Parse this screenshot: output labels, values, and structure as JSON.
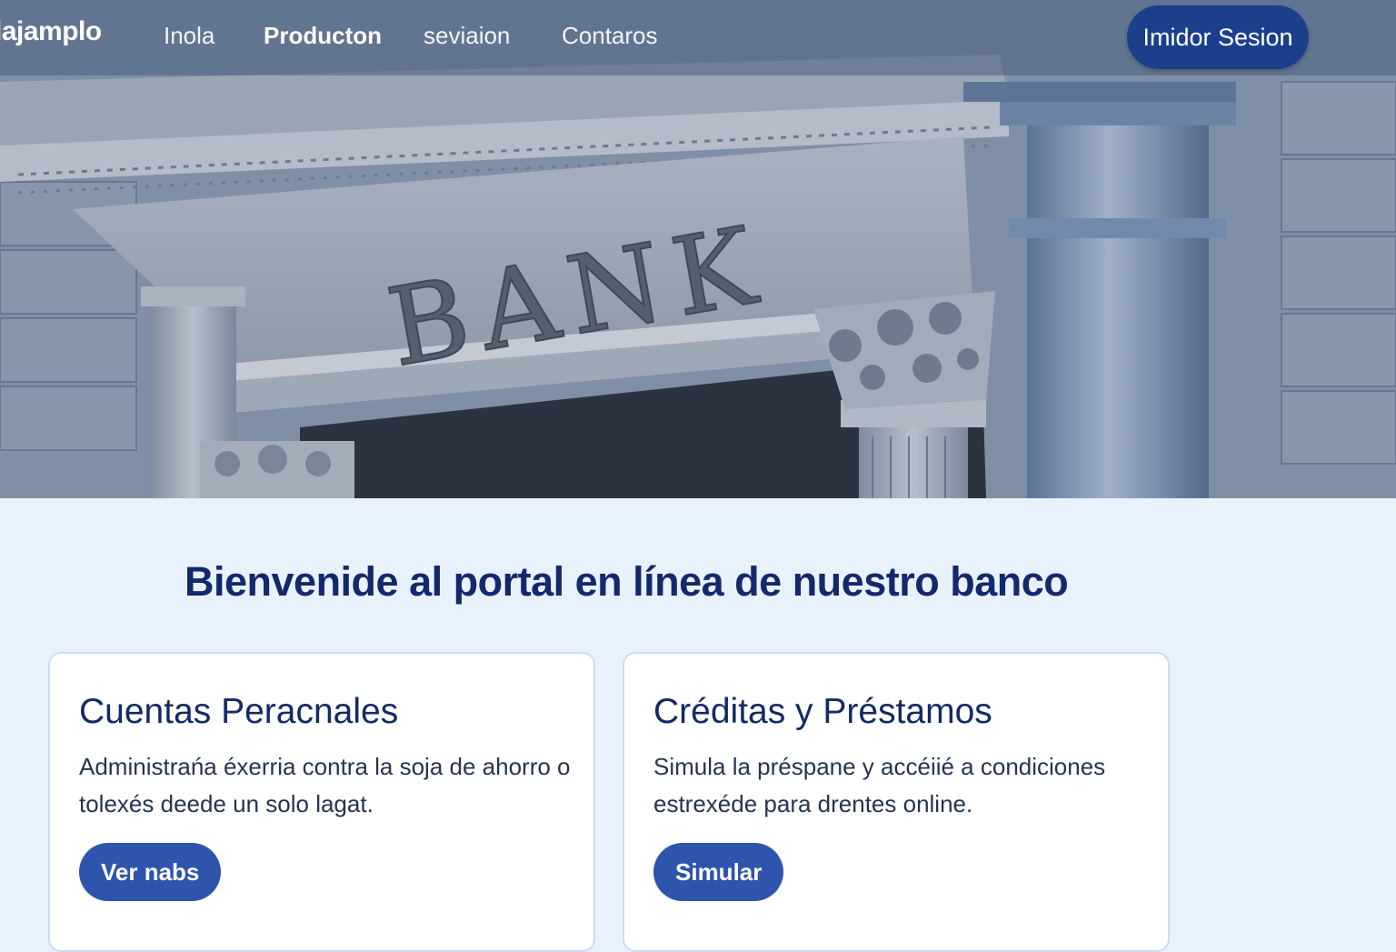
{
  "header": {
    "brand": "lajamplo",
    "nav": [
      {
        "label": "Inola"
      },
      {
        "label": "Producton"
      },
      {
        "label": "seviaion"
      },
      {
        "label": "Contaros"
      }
    ],
    "login_label": "Imidor Sesion"
  },
  "hero": {
    "engraving": "BANK"
  },
  "main": {
    "welcome": "Bienvenide al portal en línea de nuestro banco",
    "cards": [
      {
        "title": "Cuentas Peracnales",
        "text": "Administrańa éxerria contra la   soja de ahorro o tolexés deede un solo lagat.",
        "button": "Ver nabs"
      },
      {
        "title": "Créditas y Préstamos",
        "text": "Simula la préspane y accéiié a condiciones estrexéde para drentes online.",
        "button": "Simular"
      }
    ]
  },
  "colors": {
    "primary": "#1c3f8c",
    "button": "#2e54ac",
    "heading": "#14296b",
    "background": "#e8f2fd"
  }
}
